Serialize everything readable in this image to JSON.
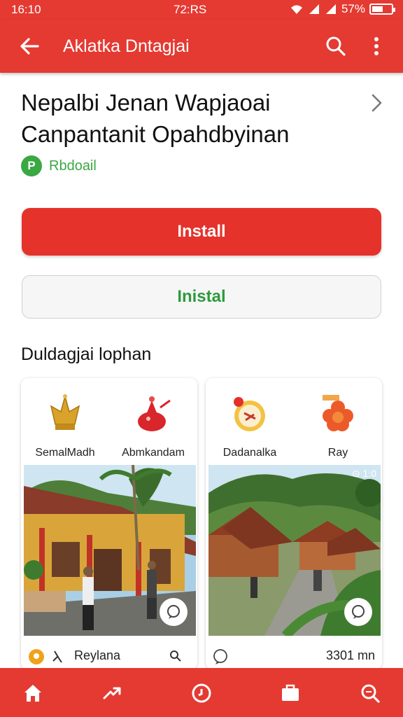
{
  "status_bar": {
    "time": "16:10",
    "center": "72:RS",
    "battery": "57%",
    "battery_level": 0.57
  },
  "app_bar": {
    "title": "Aklatka Dntagjai"
  },
  "app": {
    "title_line1": "Nepalbi Jenan Wapjaoai",
    "title_line2": "Canpantanit Opahdbyinan",
    "developer": "Rbdoail",
    "developer_initial": "P"
  },
  "buttons": {
    "install_primary": "Install",
    "install_secondary": "Inistal"
  },
  "section": {
    "title": "Duldagjai lophan"
  },
  "cards": [
    {
      "icons": [
        {
          "label": "SemalMadh",
          "icon": "golden-crown-icon"
        },
        {
          "label": "Abmkandam",
          "icon": "red-bell-icon"
        }
      ],
      "photo_badge": "",
      "footer_label": "Reylana"
    },
    {
      "icons": [
        {
          "label": "Dadanalka",
          "icon": "clock-icon"
        },
        {
          "label": "Ray",
          "icon": "flower-icon"
        }
      ],
      "photo_badge": "⊙ 1:0",
      "footer_label": "3301 mn"
    }
  ],
  "colors": {
    "primary": "#e43a32",
    "accent_green": "#3aa843"
  }
}
